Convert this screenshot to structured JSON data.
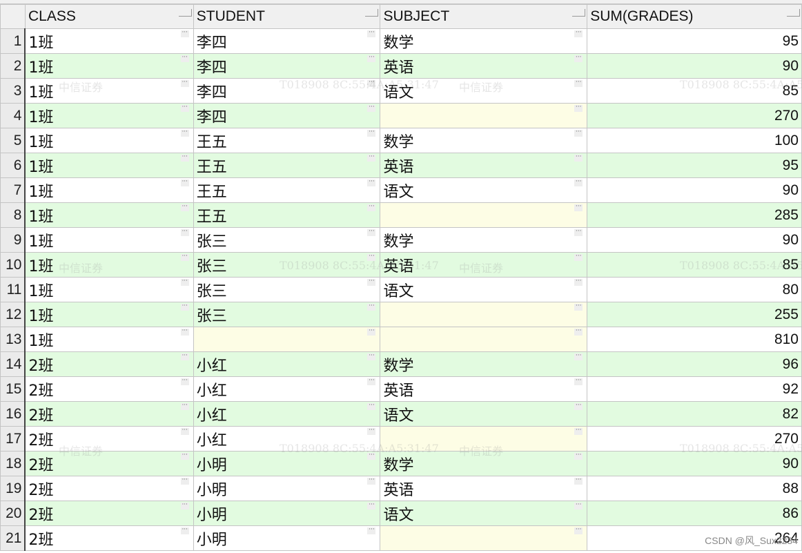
{
  "columns": [
    "CLASS",
    "STUDENT",
    "SUBJECT",
    "SUM(GRADES)"
  ],
  "rows": [
    {
      "n": "1",
      "class": "1班",
      "student": "李四",
      "subject": "数学",
      "sum": "95"
    },
    {
      "n": "2",
      "class": "1班",
      "student": "李四",
      "subject": "英语",
      "sum": "90"
    },
    {
      "n": "3",
      "class": "1班",
      "student": "李四",
      "subject": "语文",
      "sum": "85"
    },
    {
      "n": "4",
      "class": "1班",
      "student": "李四",
      "subject": "",
      "sum": "270"
    },
    {
      "n": "5",
      "class": "1班",
      "student": "王五",
      "subject": "数学",
      "sum": "100"
    },
    {
      "n": "6",
      "class": "1班",
      "student": "王五",
      "subject": "英语",
      "sum": "95"
    },
    {
      "n": "7",
      "class": "1班",
      "student": "王五",
      "subject": "语文",
      "sum": "90"
    },
    {
      "n": "8",
      "class": "1班",
      "student": "王五",
      "subject": "",
      "sum": "285"
    },
    {
      "n": "9",
      "class": "1班",
      "student": "张三",
      "subject": "数学",
      "sum": "90"
    },
    {
      "n": "10",
      "class": "1班",
      "student": "张三",
      "subject": "英语",
      "sum": "85"
    },
    {
      "n": "11",
      "class": "1班",
      "student": "张三",
      "subject": "语文",
      "sum": "80"
    },
    {
      "n": "12",
      "class": "1班",
      "student": "张三",
      "subject": "",
      "sum": "255"
    },
    {
      "n": "13",
      "class": "1班",
      "student": "",
      "subject": "",
      "sum": "810"
    },
    {
      "n": "14",
      "class": "2班",
      "student": "小红",
      "subject": "数学",
      "sum": "96"
    },
    {
      "n": "15",
      "class": "2班",
      "student": "小红",
      "subject": "英语",
      "sum": "92"
    },
    {
      "n": "16",
      "class": "2班",
      "student": "小红",
      "subject": "语文",
      "sum": "82"
    },
    {
      "n": "17",
      "class": "2班",
      "student": "小红",
      "subject": "",
      "sum": "270"
    },
    {
      "n": "18",
      "class": "2班",
      "student": "小明",
      "subject": "数学",
      "sum": "90"
    },
    {
      "n": "19",
      "class": "2班",
      "student": "小明",
      "subject": "英语",
      "sum": "88"
    },
    {
      "n": "20",
      "class": "2班",
      "student": "小明",
      "subject": "语文",
      "sum": "86"
    },
    {
      "n": "21",
      "class": "2班",
      "student": "小明",
      "subject": "",
      "sum": "264"
    }
  ],
  "ellipsis": "···",
  "watermark": {
    "a": "中信证券",
    "b": "T018908  8C:55:4A:A5:31:47"
  },
  "credit": "CSDN @风_Sux2234"
}
